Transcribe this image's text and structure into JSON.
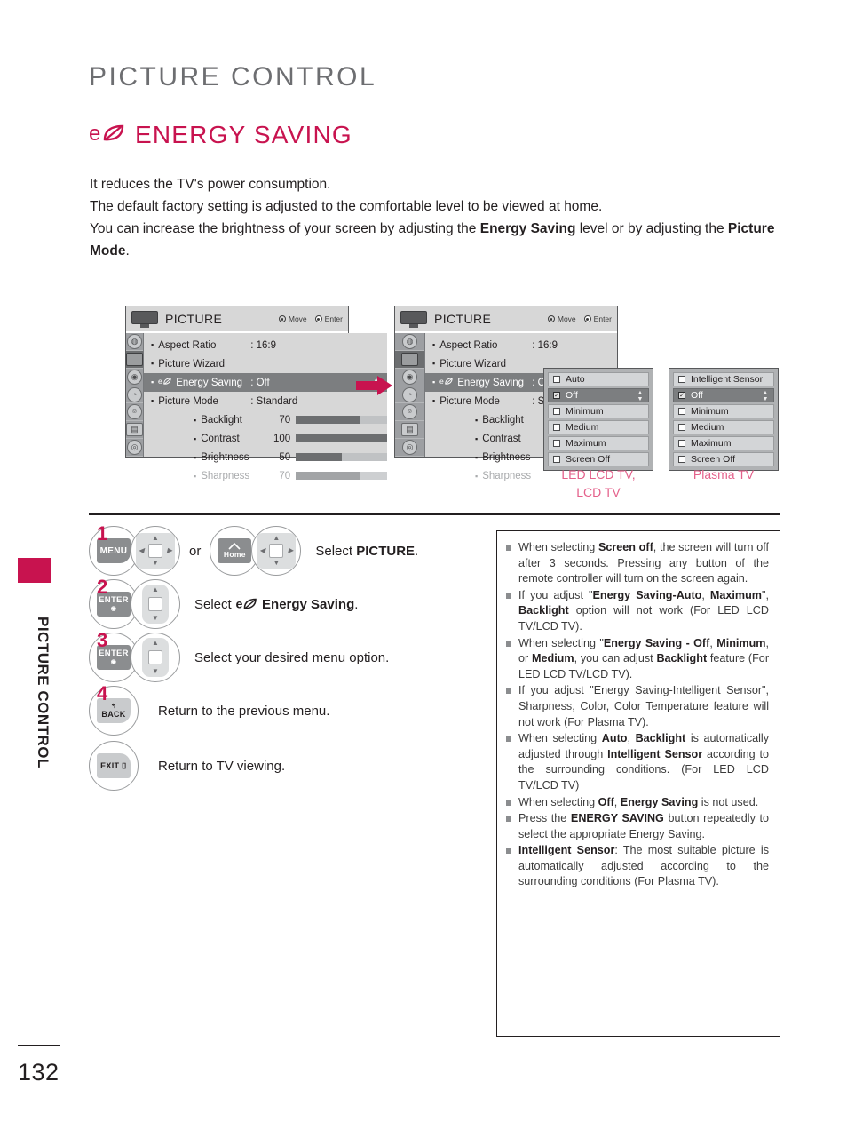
{
  "page": {
    "chapter_title": "PICTURE CONTROL",
    "section_title": "ENERGY SAVING",
    "section_icon": "eco-leaf-icon",
    "side_tab_label": "PICTURE CONTROL",
    "page_number": "132"
  },
  "intro": {
    "line1": "It reduces the TV's power consumption.",
    "line2": "The default factory setting is adjusted to the comfortable level to be viewed at home.",
    "line3_a": "You can increase the brightness of your screen by adjusting the ",
    "line3_b": "Energy Saving",
    "line3_c": " level or by adjusting the ",
    "line3_d": "Picture Mode",
    "line3_e": "."
  },
  "osd": {
    "title": "PICTURE",
    "hint_move": "Move",
    "hint_enter": "Enter",
    "sidebar_icons": [
      "setup-icon",
      "picture-icon",
      "audio-icon",
      "time-icon",
      "lock-icon",
      "option-icon",
      "network-icon"
    ],
    "rows": [
      {
        "label": "Aspect Ratio",
        "value": ": 16:9"
      },
      {
        "label": "Picture Wizard",
        "value": ""
      },
      {
        "label": "Energy Saving",
        "value": ": Off",
        "eco": true,
        "highlight": true
      },
      {
        "label": "Picture Mode",
        "value": ": Standard"
      }
    ],
    "sliders": [
      {
        "name": "Backlight",
        "value": "70",
        "pct": 70
      },
      {
        "name": "Contrast",
        "value": "100",
        "pct": 100
      },
      {
        "name": "Brightness",
        "value": "50",
        "pct": 50
      },
      {
        "name": "Sharpness",
        "value": "70",
        "pct": 70,
        "dim": true
      }
    ]
  },
  "dropdown_lcd": {
    "caption_line1": "LED LCD TV,",
    "caption_line2": "LCD TV",
    "items": [
      {
        "label": "Auto",
        "checked": false
      },
      {
        "label": "Off",
        "checked": true
      },
      {
        "label": "Minimum",
        "checked": false
      },
      {
        "label": "Medium",
        "checked": false
      },
      {
        "label": "Maximum",
        "checked": false
      },
      {
        "label": "Screen Off",
        "checked": false
      }
    ]
  },
  "dropdown_plasma": {
    "caption": "Plasma TV",
    "items": [
      {
        "label": "Intelligent Sensor",
        "checked": false
      },
      {
        "label": "Off",
        "checked": true
      },
      {
        "label": "Minimum",
        "checked": false
      },
      {
        "label": "Medium",
        "checked": false
      },
      {
        "label": "Maximum",
        "checked": false
      },
      {
        "label": "Screen Off",
        "checked": false
      }
    ]
  },
  "steps": [
    {
      "number": "1",
      "key1": "MENU",
      "or": "or",
      "key2": "Home",
      "text_pre": "Select ",
      "text_bold": "PICTURE",
      "text_post": "."
    },
    {
      "number": "2",
      "key1": "ENTER",
      "text_pre": "Select ",
      "text_bold": "Energy Saving",
      "text_post": ".",
      "eco": true
    },
    {
      "number": "3",
      "key1": "ENTER",
      "text_pre": "Select your desired menu option.",
      "text_bold": "",
      "text_post": ""
    },
    {
      "number": "4",
      "key1": "BACK",
      "text_pre": "Return to the previous menu.",
      "text_bold": "",
      "text_post": ""
    },
    {
      "number": "",
      "key1": "EXIT",
      "text_pre": "Return to TV viewing.",
      "text_bold": "",
      "text_post": ""
    }
  ],
  "notes": [
    [
      {
        "t": "When selecting "
      },
      {
        "t": "Screen off",
        "b": true
      },
      {
        "t": ", the screen will turn off after 3 seconds. Pressing any button of the remote controller will turn on the screen again."
      }
    ],
    [
      {
        "t": "If you adjust \""
      },
      {
        "t": "Energy Saving-Auto",
        "b": true
      },
      {
        "t": ", "
      },
      {
        "t": "Maximum",
        "b": true
      },
      {
        "t": "\", "
      },
      {
        "t": "Backlight",
        "b": true
      },
      {
        "t": " option will not work (For LED LCD TV/LCD TV)."
      }
    ],
    [
      {
        "t": "When selecting \""
      },
      {
        "t": "Energy Saving - Off",
        "b": true
      },
      {
        "t": ", "
      },
      {
        "t": "Minimum",
        "b": true
      },
      {
        "t": ", or "
      },
      {
        "t": "Medium",
        "b": true
      },
      {
        "t": ", you can adjust "
      },
      {
        "t": "Backlight",
        "b": true
      },
      {
        "t": " feature (For LED LCD TV/LCD TV)."
      }
    ],
    [
      {
        "t": "If you adjust \"Energy Saving-Intelligent Sensor\", Sharpness, Color, Color Temperature feature will not work (For Plasma TV)."
      }
    ],
    [
      {
        "t": "When selecting "
      },
      {
        "t": "Auto",
        "b": true
      },
      {
        "t": ", "
      },
      {
        "t": "Backlight",
        "b": true
      },
      {
        "t": " is automatically adjusted through "
      },
      {
        "t": "Intelligent Sensor",
        "b": true
      },
      {
        "t": " according to the surrounding conditions. (For LED LCD TV/LCD TV)"
      }
    ],
    [
      {
        "t": "When selecting "
      },
      {
        "t": "Off",
        "b": true
      },
      {
        "t": ", "
      },
      {
        "t": "Energy Saving",
        "b": true
      },
      {
        "t": " is not used."
      }
    ],
    [
      {
        "t": "Press the "
      },
      {
        "t": "ENERGY SAVING",
        "b": true
      },
      {
        "t": " button repeatedly to select the appropriate Energy Saving."
      }
    ],
    [
      {
        "t": "Intelligent Sensor",
        "b": true
      },
      {
        "t": ": The most suitable picture is automatically adjusted according to the surrounding conditions (For Plasma TV)."
      }
    ]
  ],
  "colors": {
    "brand": "#c8134f",
    "caption_pink": "#e4618b",
    "heading_gray": "#6d6e71"
  }
}
